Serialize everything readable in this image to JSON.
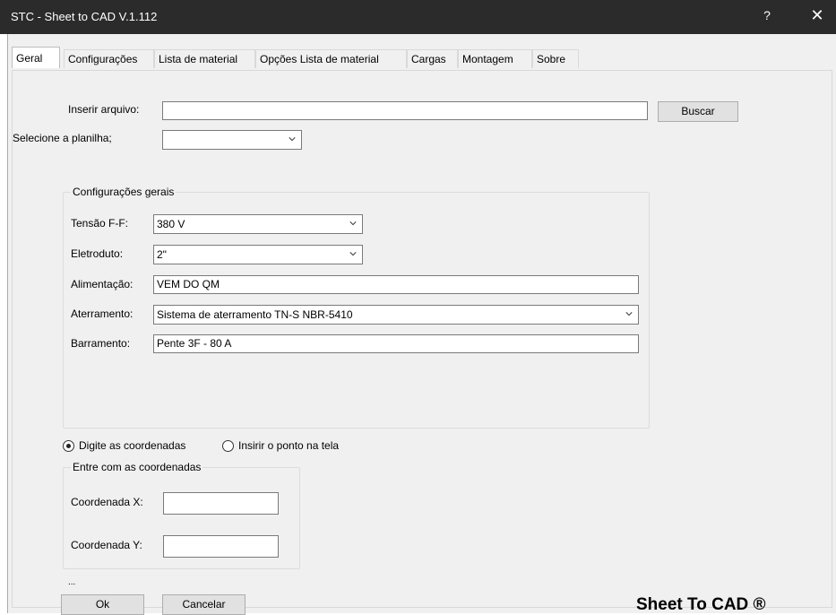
{
  "window": {
    "title": "STC - Sheet to CAD V.1.112",
    "help_label": "?",
    "close_label": "✕"
  },
  "tabs": [
    {
      "label": "Geral"
    },
    {
      "label": "Configurações"
    },
    {
      "label": "Lista de material"
    },
    {
      "label": "Opções Lista de material"
    },
    {
      "label": "Cargas"
    },
    {
      "label": "Montagem"
    },
    {
      "label": "Sobre"
    }
  ],
  "file": {
    "label": "Inserir arquivo:",
    "value": "",
    "button": "Buscar",
    "sheet_label": "Selecione a planilha;",
    "sheet_value": ""
  },
  "general": {
    "legend": "Configurações gerais",
    "tensao_label": "Tensão F-F:",
    "tensao_value": "380 V",
    "eletroduto_label": "Eletroduto:",
    "eletroduto_value": "2\"",
    "alimentacao_label": "Alimentação:",
    "alimentacao_value": "VEM DO QM",
    "aterramento_label": "Aterramento:",
    "aterramento_value": "Sistema de aterramento TN-S NBR-5410",
    "barramento_label": "Barramento:",
    "barramento_value": "Pente 3F - 80 A"
  },
  "coords": {
    "radio_type": "Digite as coordenadas",
    "radio_pick": "Insirir o ponto na tela",
    "legend": "Entre com as coordenadas",
    "x_label": "Coordenada X:",
    "x_value": "",
    "y_label": "Coordenada Y:",
    "y_value": ""
  },
  "footer": {
    "ellipsis": "...",
    "ok": "Ok",
    "cancel": "Cancelar",
    "brand": "Sheet To CAD ®"
  }
}
